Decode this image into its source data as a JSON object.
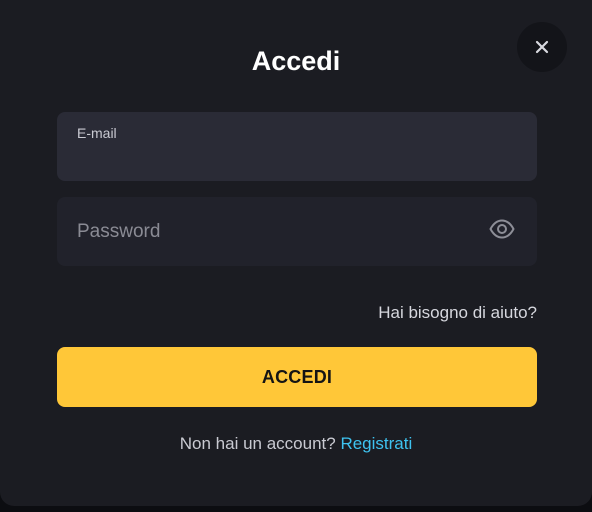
{
  "dialog": {
    "title": "Accedi",
    "close_icon": "close-icon"
  },
  "form": {
    "email": {
      "label": "E-mail",
      "value": ""
    },
    "password": {
      "placeholder": "Password",
      "value": "",
      "toggle_icon": "eye-icon"
    },
    "help_link": "Hai bisogno di aiuto?",
    "submit_label": "ACCEDI"
  },
  "signup": {
    "prompt": "Non hai un account?",
    "link_label": "Registrati"
  },
  "colors": {
    "background": "#1b1c22",
    "field_focused": "#2a2b36",
    "field": "#21222b",
    "accent_button": "#ffc738",
    "link": "#3ec3f0"
  }
}
